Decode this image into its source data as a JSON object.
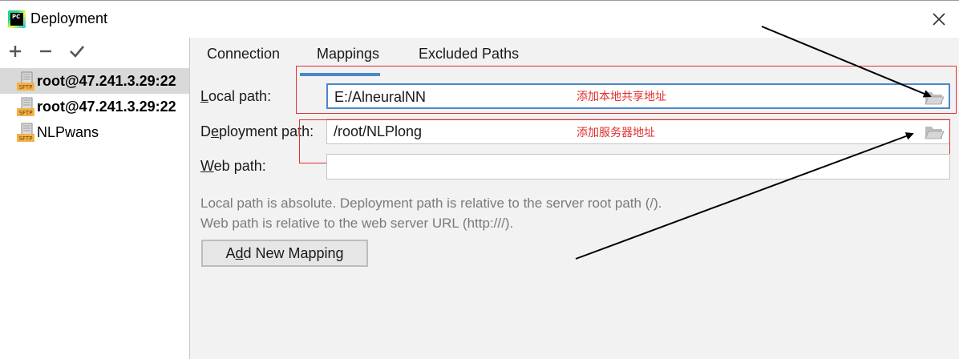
{
  "window": {
    "title": "Deployment",
    "app_icon_text": "PC"
  },
  "toolbar": {
    "add_icon": "plus-icon",
    "remove_icon": "minus-icon",
    "apply_icon": "checkmark-icon"
  },
  "servers": [
    {
      "label": "root@47.241.3.29:22",
      "icon": "sftp-icon",
      "icon_text": "SFTP",
      "selected": true,
      "bold": true
    },
    {
      "label": "root@47.241.3.29:22",
      "icon": "sftp-icon",
      "icon_text": "SFTP",
      "selected": false,
      "bold": true
    },
    {
      "label": "NLPwans",
      "icon": "sftp-icon",
      "icon_text": "SFTP",
      "selected": false,
      "bold": false
    }
  ],
  "tabs": [
    {
      "label": "Connection",
      "active": false
    },
    {
      "label": "Mappings",
      "active": true
    },
    {
      "label": "Excluded Paths",
      "active": false
    }
  ],
  "mappings": {
    "local_path_label_u": "L",
    "local_path_label_rest": "ocal path:",
    "local_path_value": "E:/AlneuralNN",
    "deployment_path_label_pre": "D",
    "deployment_path_label_u": "e",
    "deployment_path_label_rest": "ployment path:",
    "deployment_path_value": "/root/NLPlong",
    "web_path_label_u": "W",
    "web_path_label_rest": "eb path:",
    "web_path_value": "",
    "hint_line1": "Local path is absolute. Deployment path is relative to the server root path (/).",
    "hint_line2": "Web path is relative to the web server URL (http:///).",
    "add_mapping_pre": "A",
    "add_mapping_u": "d",
    "add_mapping_rest": "d New Mapping"
  },
  "annotations": {
    "local_note": "添加本地共享地址",
    "deploy_note": "添加服务器地址",
    "color": "#e03030"
  },
  "colors": {
    "accent": "#4a88c7",
    "selection": "#d9d9d9",
    "background": "#f2f2f2"
  }
}
